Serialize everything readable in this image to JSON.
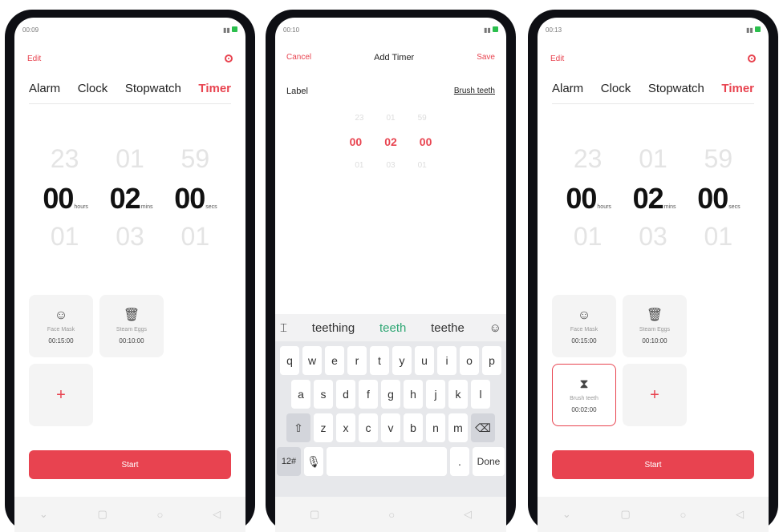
{
  "phone1": {
    "status": {
      "time": "00:09",
      "right": "•••"
    },
    "edit_label": "Edit",
    "tabs": [
      {
        "label": "Alarm"
      },
      {
        "label": "Clock"
      },
      {
        "label": "Stopwatch"
      },
      {
        "label": "Timer"
      }
    ],
    "picker": {
      "prev": [
        "23",
        "01",
        "59"
      ],
      "current": [
        "00",
        "02",
        "00"
      ],
      "units": [
        "hours",
        "mins",
        "secs"
      ],
      "next": [
        "01",
        "03",
        "01"
      ]
    },
    "presets": [
      {
        "name": "Face Mask",
        "time": "00:15:00"
      },
      {
        "name": "Steam Eggs",
        "time": "00:10:00"
      }
    ],
    "add_label": "+",
    "start_label": "Start"
  },
  "phone2": {
    "status": {
      "time": "00:10"
    },
    "cancel_label": "Cancel",
    "title": "Add Timer",
    "save_label": "Save",
    "label_field": {
      "label": "Label",
      "value": "Brush teeth"
    },
    "picker": {
      "prev": [
        "23",
        "01",
        "59"
      ],
      "current": [
        "00",
        "02",
        "00"
      ],
      "next": [
        "01",
        "03",
        "01"
      ]
    },
    "suggestions": [
      "teething",
      "teeth",
      "teethe"
    ],
    "keys_row1": [
      "q",
      "w",
      "e",
      "r",
      "t",
      "y",
      "u",
      "i",
      "o",
      "p"
    ],
    "keys_row2": [
      "a",
      "s",
      "d",
      "f",
      "g",
      "h",
      "j",
      "k",
      "l"
    ],
    "keys_row3": [
      "z",
      "x",
      "c",
      "v",
      "b",
      "n",
      "m"
    ],
    "num_key": "12#",
    "done_key": "Done"
  },
  "phone3": {
    "status": {
      "time": "00:13"
    },
    "edit_label": "Edit",
    "tabs": [
      {
        "label": "Alarm"
      },
      {
        "label": "Clock"
      },
      {
        "label": "Stopwatch"
      },
      {
        "label": "Timer"
      }
    ],
    "picker": {
      "prev": [
        "23",
        "01",
        "59"
      ],
      "current": [
        "00",
        "02",
        "00"
      ],
      "units": [
        "hours",
        "mins",
        "secs"
      ],
      "next": [
        "01",
        "03",
        "01"
      ]
    },
    "presets": [
      {
        "name": "Face Mask",
        "time": "00:15:00"
      },
      {
        "name": "Steam Eggs",
        "time": "00:10:00"
      },
      {
        "name": "Brush teeth",
        "time": "00:02:00"
      }
    ],
    "add_label": "+",
    "start_label": "Start"
  },
  "colors": {
    "accent": "#e84450",
    "start_button": "#e84350",
    "suggestion_highlight": "#2fa774"
  },
  "icons": [
    "settings-icon",
    "face-mask-icon",
    "trash-icon",
    "hourglass-icon",
    "plus-icon",
    "nav-back-icon",
    "nav-home-icon",
    "nav-recents-icon"
  ]
}
